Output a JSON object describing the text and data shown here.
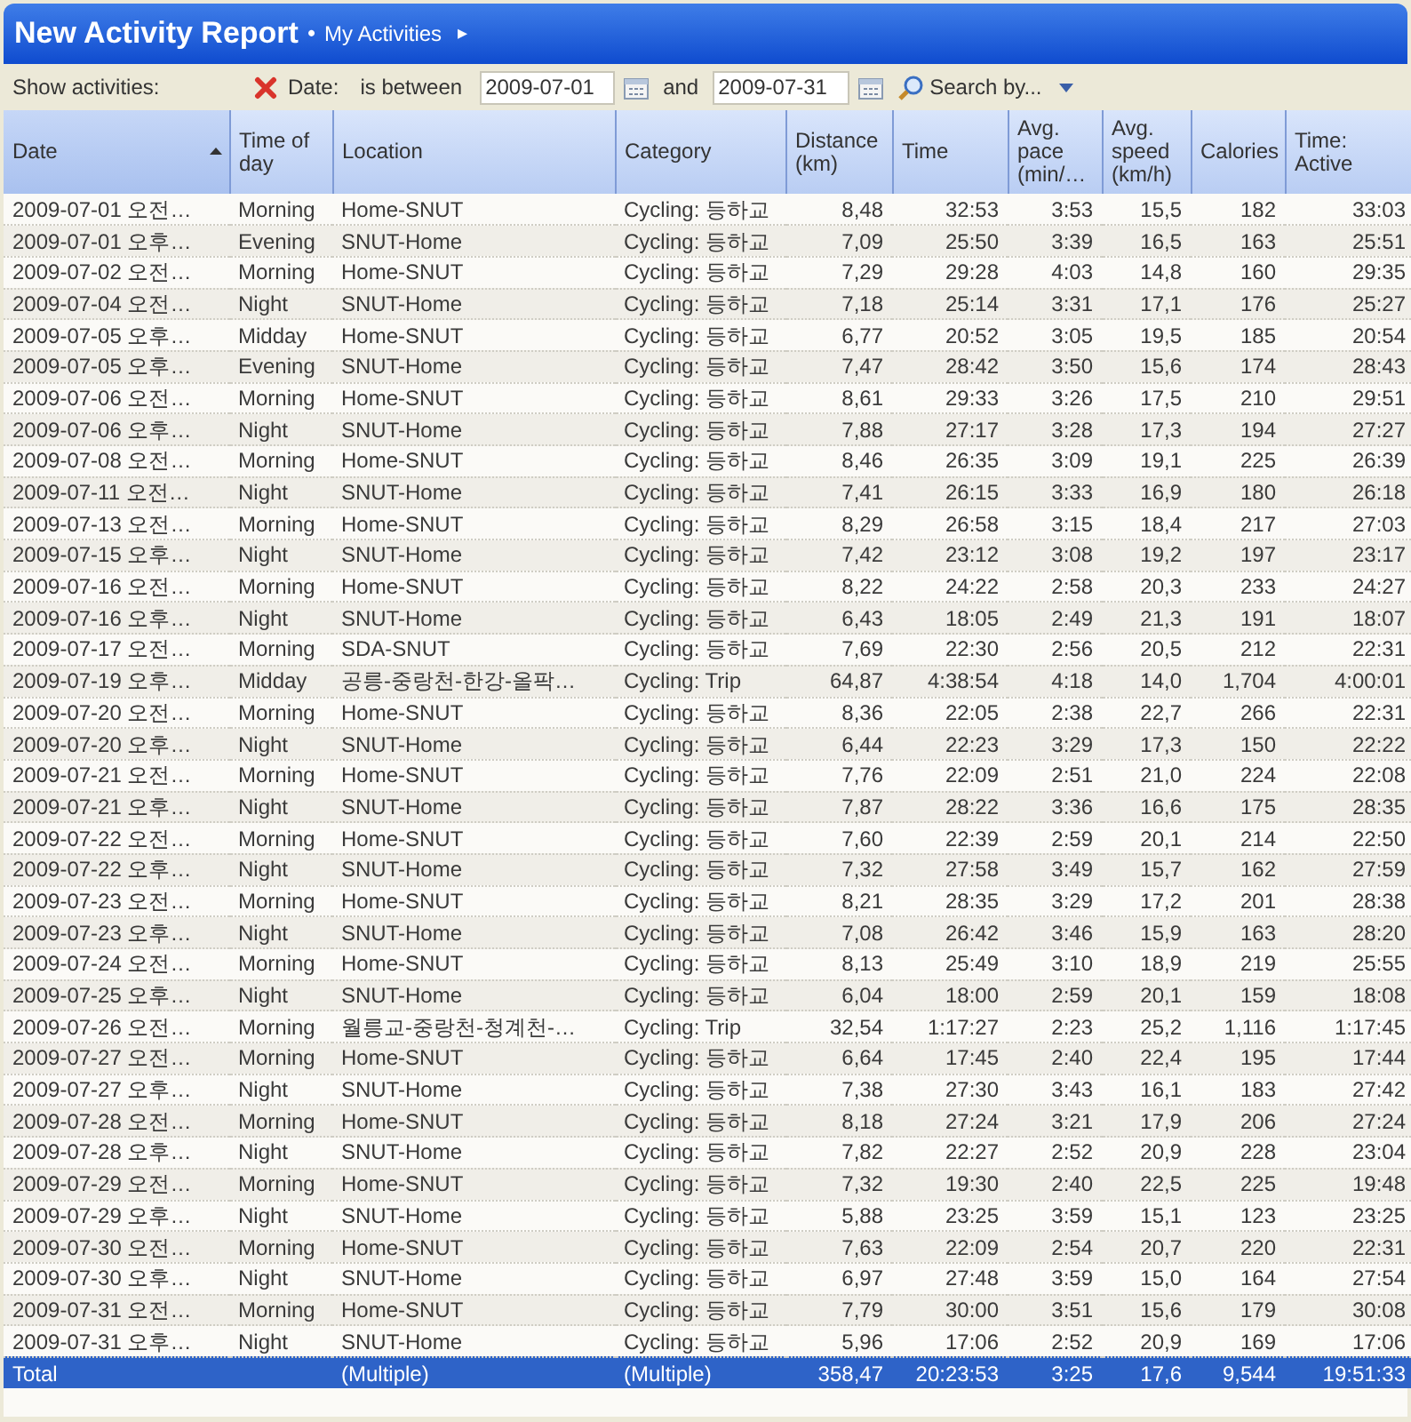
{
  "title_bar": {
    "title": "New Activity Report",
    "breadcrumb": "My Activities",
    "bullet": "•",
    "arrow": "▸"
  },
  "filter_bar": {
    "label": "Show activities:",
    "field": "Date:",
    "operator": "is between",
    "from": "2009-07-01",
    "joiner": "and",
    "to": "2009-07-31",
    "search": "Search by..."
  },
  "table": {
    "columns": [
      {
        "label": "Date",
        "sorted": true
      },
      {
        "label": "Time of day",
        "sorted": false
      },
      {
        "label": "Location",
        "sorted": false
      },
      {
        "label": "Category",
        "sorted": false
      },
      {
        "label": "Distance (km)",
        "sorted": false
      },
      {
        "label": "Time",
        "sorted": false
      },
      {
        "label": "Avg. pace (min/…",
        "sorted": false
      },
      {
        "label": "Avg. speed (km/h)",
        "sorted": false
      },
      {
        "label": "Calories",
        "sorted": false
      },
      {
        "label": "Time: Active",
        "sorted": false
      }
    ],
    "rows": [
      [
        "2009-07-01 오전…",
        "Morning",
        "Home-SNUT",
        "Cycling: 등하교",
        "8,48",
        "32:53",
        "3:53",
        "15,5",
        "182",
        "33:03"
      ],
      [
        "2009-07-01 오후…",
        "Evening",
        "SNUT-Home",
        "Cycling: 등하교",
        "7,09",
        "25:50",
        "3:39",
        "16,5",
        "163",
        "25:51"
      ],
      [
        "2009-07-02 오전…",
        "Morning",
        "Home-SNUT",
        "Cycling: 등하교",
        "7,29",
        "29:28",
        "4:03",
        "14,8",
        "160",
        "29:35"
      ],
      [
        "2009-07-04 오전…",
        "Night",
        "SNUT-Home",
        "Cycling: 등하교",
        "7,18",
        "25:14",
        "3:31",
        "17,1",
        "176",
        "25:27"
      ],
      [
        "2009-07-05 오후…",
        "Midday",
        "Home-SNUT",
        "Cycling: 등하교",
        "6,77",
        "20:52",
        "3:05",
        "19,5",
        "185",
        "20:54"
      ],
      [
        "2009-07-05 오후…",
        "Evening",
        "SNUT-Home",
        "Cycling: 등하교",
        "7,47",
        "28:42",
        "3:50",
        "15,6",
        "174",
        "28:43"
      ],
      [
        "2009-07-06 오전…",
        "Morning",
        "Home-SNUT",
        "Cycling: 등하교",
        "8,61",
        "29:33",
        "3:26",
        "17,5",
        "210",
        "29:51"
      ],
      [
        "2009-07-06 오후…",
        "Night",
        "SNUT-Home",
        "Cycling: 등하교",
        "7,88",
        "27:17",
        "3:28",
        "17,3",
        "194",
        "27:27"
      ],
      [
        "2009-07-08 오전…",
        "Morning",
        "Home-SNUT",
        "Cycling: 등하교",
        "8,46",
        "26:35",
        "3:09",
        "19,1",
        "225",
        "26:39"
      ],
      [
        "2009-07-11 오전…",
        "Night",
        "SNUT-Home",
        "Cycling: 등하교",
        "7,41",
        "26:15",
        "3:33",
        "16,9",
        "180",
        "26:18"
      ],
      [
        "2009-07-13 오전…",
        "Morning",
        "Home-SNUT",
        "Cycling: 등하교",
        "8,29",
        "26:58",
        "3:15",
        "18,4",
        "217",
        "27:03"
      ],
      [
        "2009-07-15 오후…",
        "Night",
        "SNUT-Home",
        "Cycling: 등하교",
        "7,42",
        "23:12",
        "3:08",
        "19,2",
        "197",
        "23:17"
      ],
      [
        "2009-07-16 오전…",
        "Morning",
        "Home-SNUT",
        "Cycling: 등하교",
        "8,22",
        "24:22",
        "2:58",
        "20,3",
        "233",
        "24:27"
      ],
      [
        "2009-07-16 오후…",
        "Night",
        "SNUT-Home",
        "Cycling: 등하교",
        "6,43",
        "18:05",
        "2:49",
        "21,3",
        "191",
        "18:07"
      ],
      [
        "2009-07-17 오전…",
        "Morning",
        "SDA-SNUT",
        "Cycling: 등하교",
        "7,69",
        "22:30",
        "2:56",
        "20,5",
        "212",
        "22:31"
      ],
      [
        "2009-07-19 오후…",
        "Midday",
        "공릉-중랑천-한강-올팍…",
        "Cycling: Trip",
        "64,87",
        "4:38:54",
        "4:18",
        "14,0",
        "1,704",
        "4:00:01"
      ],
      [
        "2009-07-20 오전…",
        "Morning",
        "Home-SNUT",
        "Cycling: 등하교",
        "8,36",
        "22:05",
        "2:38",
        "22,7",
        "266",
        "22:31"
      ],
      [
        "2009-07-20 오후…",
        "Night",
        "SNUT-Home",
        "Cycling: 등하교",
        "6,44",
        "22:23",
        "3:29",
        "17,3",
        "150",
        "22:22"
      ],
      [
        "2009-07-21 오전…",
        "Morning",
        "Home-SNUT",
        "Cycling: 등하교",
        "7,76",
        "22:09",
        "2:51",
        "21,0",
        "224",
        "22:08"
      ],
      [
        "2009-07-21 오후…",
        "Night",
        "SNUT-Home",
        "Cycling: 등하교",
        "7,87",
        "28:22",
        "3:36",
        "16,6",
        "175",
        "28:35"
      ],
      [
        "2009-07-22 오전…",
        "Morning",
        "Home-SNUT",
        "Cycling: 등하교",
        "7,60",
        "22:39",
        "2:59",
        "20,1",
        "214",
        "22:50"
      ],
      [
        "2009-07-22 오후…",
        "Night",
        "SNUT-Home",
        "Cycling: 등하교",
        "7,32",
        "27:58",
        "3:49",
        "15,7",
        "162",
        "27:59"
      ],
      [
        "2009-07-23 오전…",
        "Morning",
        "Home-SNUT",
        "Cycling: 등하교",
        "8,21",
        "28:35",
        "3:29",
        "17,2",
        "201",
        "28:38"
      ],
      [
        "2009-07-23 오후…",
        "Night",
        "SNUT-Home",
        "Cycling: 등하교",
        "7,08",
        "26:42",
        "3:46",
        "15,9",
        "163",
        "28:20"
      ],
      [
        "2009-07-24 오전…",
        "Morning",
        "Home-SNUT",
        "Cycling: 등하교",
        "8,13",
        "25:49",
        "3:10",
        "18,9",
        "219",
        "25:55"
      ],
      [
        "2009-07-25 오후…",
        "Night",
        "SNUT-Home",
        "Cycling: 등하교",
        "6,04",
        "18:00",
        "2:59",
        "20,1",
        "159",
        "18:08"
      ],
      [
        "2009-07-26 오전…",
        "Morning",
        "월릉교-중랑천-청계천-…",
        "Cycling: Trip",
        "32,54",
        "1:17:27",
        "2:23",
        "25,2",
        "1,116",
        "1:17:45"
      ],
      [
        "2009-07-27 오전…",
        "Morning",
        "Home-SNUT",
        "Cycling: 등하교",
        "6,64",
        "17:45",
        "2:40",
        "22,4",
        "195",
        "17:44"
      ],
      [
        "2009-07-27 오후…",
        "Night",
        "SNUT-Home",
        "Cycling: 등하교",
        "7,38",
        "27:30",
        "3:43",
        "16,1",
        "183",
        "27:42"
      ],
      [
        "2009-07-28 오전…",
        "Morning",
        "Home-SNUT",
        "Cycling: 등하교",
        "8,18",
        "27:24",
        "3:21",
        "17,9",
        "206",
        "27:24"
      ],
      [
        "2009-07-28 오후…",
        "Night",
        "SNUT-Home",
        "Cycling: 등하교",
        "7,82",
        "22:27",
        "2:52",
        "20,9",
        "228",
        "23:04"
      ],
      [
        "2009-07-29 오전…",
        "Morning",
        "Home-SNUT",
        "Cycling: 등하교",
        "7,32",
        "19:30",
        "2:40",
        "22,5",
        "225",
        "19:48"
      ],
      [
        "2009-07-29 오후…",
        "Night",
        "SNUT-Home",
        "Cycling: 등하교",
        "5,88",
        "23:25",
        "3:59",
        "15,1",
        "123",
        "23:25"
      ],
      [
        "2009-07-30 오전…",
        "Morning",
        "Home-SNUT",
        "Cycling: 등하교",
        "7,63",
        "22:09",
        "2:54",
        "20,7",
        "220",
        "22:31"
      ],
      [
        "2009-07-30 오후…",
        "Night",
        "SNUT-Home",
        "Cycling: 등하교",
        "6,97",
        "27:48",
        "3:59",
        "15,0",
        "164",
        "27:54"
      ],
      [
        "2009-07-31 오전…",
        "Morning",
        "Home-SNUT",
        "Cycling: 등하교",
        "7,79",
        "30:00",
        "3:51",
        "15,6",
        "179",
        "30:08"
      ],
      [
        "2009-07-31 오후…",
        "Night",
        "SNUT-Home",
        "Cycling: 등하교",
        "5,96",
        "17:06",
        "2:52",
        "20,9",
        "169",
        "17:06"
      ]
    ],
    "total": {
      "label": "Total",
      "location": "(Multiple)",
      "category": "(Multiple)",
      "distance": "358,47",
      "time": "20:23:53",
      "pace": "3:25",
      "speed": "17,6",
      "calories": "9,544",
      "active": "19:51:33"
    }
  }
}
